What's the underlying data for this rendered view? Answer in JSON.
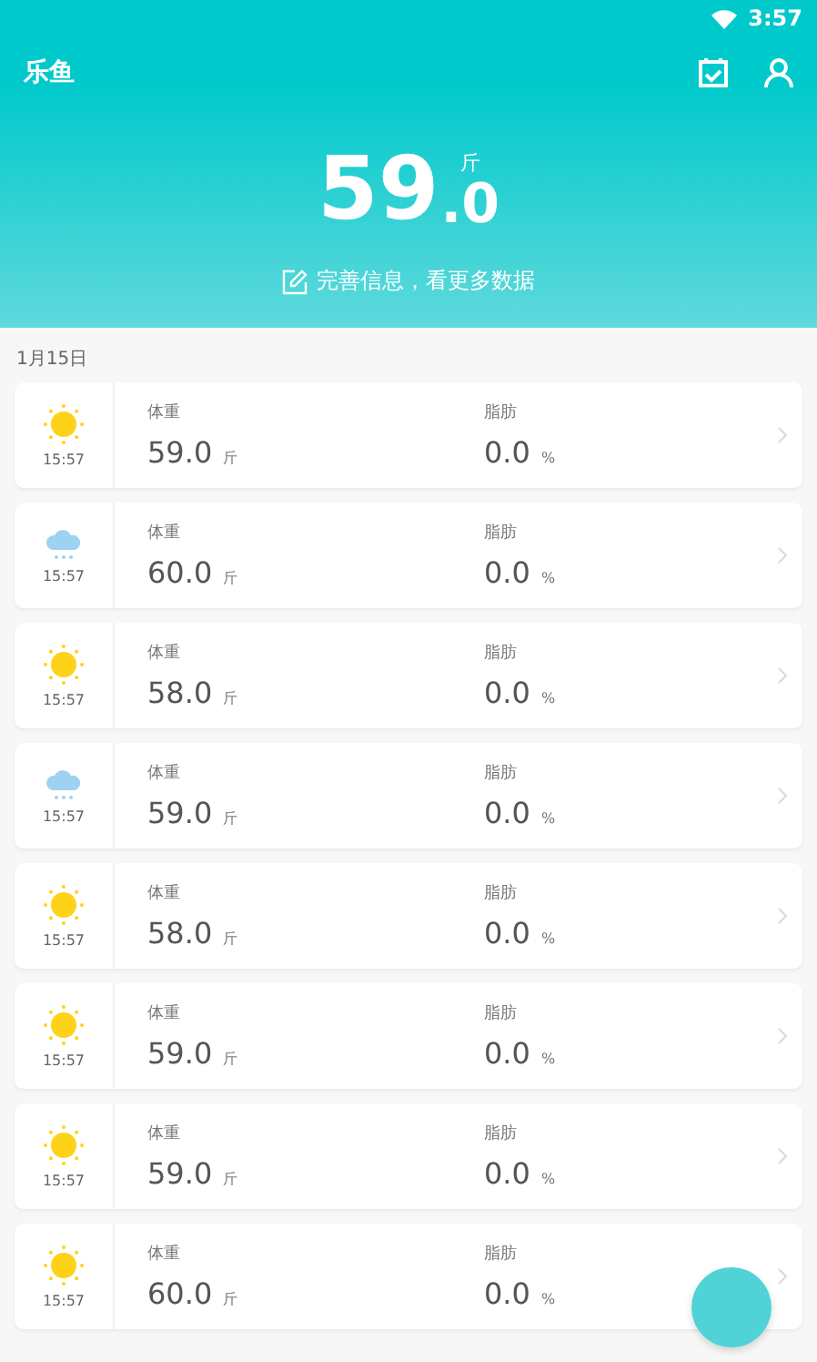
{
  "status_bar": {
    "time": "3:57"
  },
  "app_bar": {
    "title": "乐鱼"
  },
  "summary": {
    "integer": "59",
    "decimal": ".0",
    "unit": "斤",
    "hint": "完善信息，看更多数据"
  },
  "date": "1月15日",
  "records": [
    {
      "kind": "sunny",
      "time": "15:57",
      "weight_label": "体重",
      "weight": "59.0",
      "weight_unit": "斤",
      "fat_label": "脂肪",
      "fat": "0.0",
      "fat_unit": "%"
    },
    {
      "kind": "rainy",
      "time": "15:57",
      "weight_label": "体重",
      "weight": "60.0",
      "weight_unit": "斤",
      "fat_label": "脂肪",
      "fat": "0.0",
      "fat_unit": "%"
    },
    {
      "kind": "sunny",
      "time": "15:57",
      "weight_label": "体重",
      "weight": "58.0",
      "weight_unit": "斤",
      "fat_label": "脂肪",
      "fat": "0.0",
      "fat_unit": "%"
    },
    {
      "kind": "rainy",
      "time": "15:57",
      "weight_label": "体重",
      "weight": "59.0",
      "weight_unit": "斤",
      "fat_label": "脂肪",
      "fat": "0.0",
      "fat_unit": "%"
    },
    {
      "kind": "sunny",
      "time": "15:57",
      "weight_label": "体重",
      "weight": "58.0",
      "weight_unit": "斤",
      "fat_label": "脂肪",
      "fat": "0.0",
      "fat_unit": "%"
    },
    {
      "kind": "sunny",
      "time": "15:57",
      "weight_label": "体重",
      "weight": "59.0",
      "weight_unit": "斤",
      "fat_label": "脂肪",
      "fat": "0.0",
      "fat_unit": "%"
    },
    {
      "kind": "sunny",
      "time": "15:57",
      "weight_label": "体重",
      "weight": "59.0",
      "weight_unit": "斤",
      "fat_label": "脂肪",
      "fat": "0.0",
      "fat_unit": "%"
    },
    {
      "kind": "sunny",
      "time": "15:57",
      "weight_label": "体重",
      "weight": "60.0",
      "weight_unit": "斤",
      "fat_label": "脂肪",
      "fat": "0.0",
      "fat_unit": "%"
    }
  ]
}
